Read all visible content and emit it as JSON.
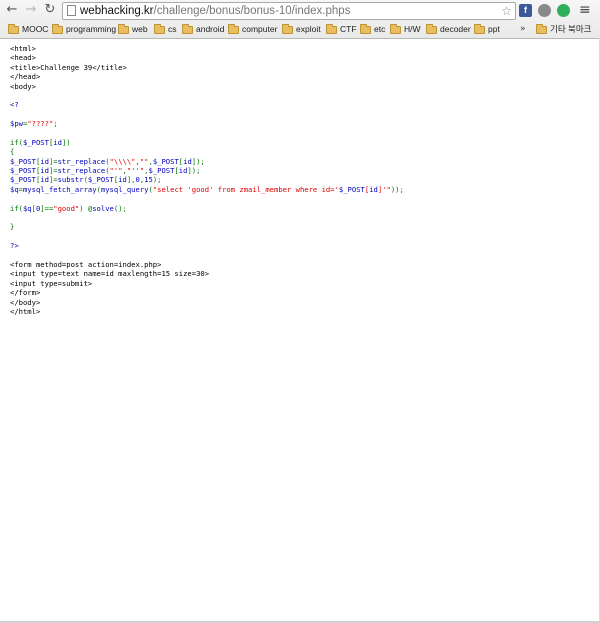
{
  "browser": {
    "url_host": "webhacking.kr",
    "url_path": "/challenge/bonus/bonus-10/index.phps",
    "back_glyph": "←",
    "forward_glyph": "→",
    "reload_glyph": "↻",
    "star_glyph": "☆",
    "menu_glyph": "≡",
    "extensions": [
      {
        "icon": "facebook-icon",
        "letter": "f",
        "color": "#3b5998"
      },
      {
        "icon": "shield-extension-icon",
        "letter": "",
        "color": "#8a8a8a"
      },
      {
        "icon": "globe-extension-icon",
        "letter": "",
        "color": "#9a9a9a"
      },
      {
        "icon": "green-circle-extension-icon",
        "letter": "",
        "color": "#2fae5b"
      }
    ]
  },
  "bookmarks": {
    "items": [
      "MOOC",
      "programming",
      "web",
      "cs",
      "android",
      "computer",
      "exploit",
      "CTF",
      "etc",
      "H/W",
      "decoder",
      "ppt"
    ],
    "overflow": "»",
    "other": "기타 북마크"
  },
  "source": {
    "lines": [
      [
        {
          "t": "<html>",
          "c": "black"
        }
      ],
      [
        {
          "t": "<head>",
          "c": "black"
        }
      ],
      [
        {
          "t": "<title>Challenge 39</title>",
          "c": "black"
        }
      ],
      [
        {
          "t": "</head>",
          "c": "black"
        }
      ],
      [
        {
          "t": "<body>",
          "c": "black"
        }
      ],
      [],
      [
        {
          "t": "<?",
          "c": "blue"
        }
      ],
      [],
      [
        {
          "t": "$pw",
          "c": "blue"
        },
        {
          "t": "=",
          "c": "green"
        },
        {
          "t": "\"????\"",
          "c": "red"
        },
        {
          "t": ";",
          "c": "green"
        }
      ],
      [],
      [
        {
          "t": "if(",
          "c": "green"
        },
        {
          "t": "$_POST",
          "c": "blue"
        },
        {
          "t": "[",
          "c": "green"
        },
        {
          "t": "id",
          "c": "blue"
        },
        {
          "t": "])",
          "c": "green"
        }
      ],
      [
        {
          "t": "{",
          "c": "green"
        }
      ],
      [
        {
          "t": "$_POST",
          "c": "blue"
        },
        {
          "t": "[",
          "c": "green"
        },
        {
          "t": "id",
          "c": "blue"
        },
        {
          "t": "]=",
          "c": "green"
        },
        {
          "t": "str_replace",
          "c": "blue"
        },
        {
          "t": "(",
          "c": "green"
        },
        {
          "t": "\"\\\\\\\\\"",
          "c": "red"
        },
        {
          "t": ",",
          "c": "green"
        },
        {
          "t": "\"\"",
          "c": "red"
        },
        {
          "t": ",",
          "c": "green"
        },
        {
          "t": "$_POST",
          "c": "blue"
        },
        {
          "t": "[",
          "c": "green"
        },
        {
          "t": "id",
          "c": "blue"
        },
        {
          "t": "]);",
          "c": "green"
        }
      ],
      [
        {
          "t": "$_POST",
          "c": "blue"
        },
        {
          "t": "[",
          "c": "green"
        },
        {
          "t": "id",
          "c": "blue"
        },
        {
          "t": "]=",
          "c": "green"
        },
        {
          "t": "str_replace",
          "c": "blue"
        },
        {
          "t": "(",
          "c": "green"
        },
        {
          "t": "\"'\"",
          "c": "red"
        },
        {
          "t": ",",
          "c": "green"
        },
        {
          "t": "\"''\"",
          "c": "red"
        },
        {
          "t": ",",
          "c": "green"
        },
        {
          "t": "$_POST",
          "c": "blue"
        },
        {
          "t": "[",
          "c": "green"
        },
        {
          "t": "id",
          "c": "blue"
        },
        {
          "t": "]);",
          "c": "green"
        }
      ],
      [
        {
          "t": "$_POST",
          "c": "blue"
        },
        {
          "t": "[",
          "c": "green"
        },
        {
          "t": "id",
          "c": "blue"
        },
        {
          "t": "]=",
          "c": "green"
        },
        {
          "t": "substr",
          "c": "blue"
        },
        {
          "t": "(",
          "c": "green"
        },
        {
          "t": "$_POST",
          "c": "blue"
        },
        {
          "t": "[",
          "c": "green"
        },
        {
          "t": "id",
          "c": "blue"
        },
        {
          "t": "],",
          "c": "green"
        },
        {
          "t": "0",
          "c": "blue"
        },
        {
          "t": ",",
          "c": "green"
        },
        {
          "t": "15",
          "c": "blue"
        },
        {
          "t": ");",
          "c": "green"
        }
      ],
      [
        {
          "t": "$q",
          "c": "blue"
        },
        {
          "t": "=",
          "c": "green"
        },
        {
          "t": "mysql_fetch_array",
          "c": "blue"
        },
        {
          "t": "(",
          "c": "green"
        },
        {
          "t": "mysql_query",
          "c": "blue"
        },
        {
          "t": "(",
          "c": "green"
        },
        {
          "t": "\"select 'good' from zmail_member where id='",
          "c": "red"
        },
        {
          "t": "$_POST",
          "c": "blue"
        },
        {
          "t": "[",
          "c": "red"
        },
        {
          "t": "id",
          "c": "blue"
        },
        {
          "t": "]'\"",
          "c": "red"
        },
        {
          "t": "));",
          "c": "green"
        }
      ],
      [],
      [
        {
          "t": "if(",
          "c": "green"
        },
        {
          "t": "$q",
          "c": "blue"
        },
        {
          "t": "[",
          "c": "green"
        },
        {
          "t": "0",
          "c": "blue"
        },
        {
          "t": "]==",
          "c": "green"
        },
        {
          "t": "\"good\"",
          "c": "red"
        },
        {
          "t": ") @",
          "c": "green"
        },
        {
          "t": "solve",
          "c": "blue"
        },
        {
          "t": "();",
          "c": "green"
        }
      ],
      [],
      [
        {
          "t": "}",
          "c": "green"
        }
      ],
      [],
      [
        {
          "t": "?>",
          "c": "blue"
        }
      ],
      [],
      [
        {
          "t": "<form method=post action=index.php>",
          "c": "black"
        }
      ],
      [
        {
          "t": "<input type=text name=id maxlength=15 size=30>",
          "c": "black"
        }
      ],
      [
        {
          "t": "<input type=submit>",
          "c": "black"
        }
      ],
      [
        {
          "t": "</form>",
          "c": "black"
        }
      ],
      [
        {
          "t": "</body>",
          "c": "black"
        }
      ],
      [
        {
          "t": "</html>",
          "c": "black"
        }
      ]
    ]
  }
}
